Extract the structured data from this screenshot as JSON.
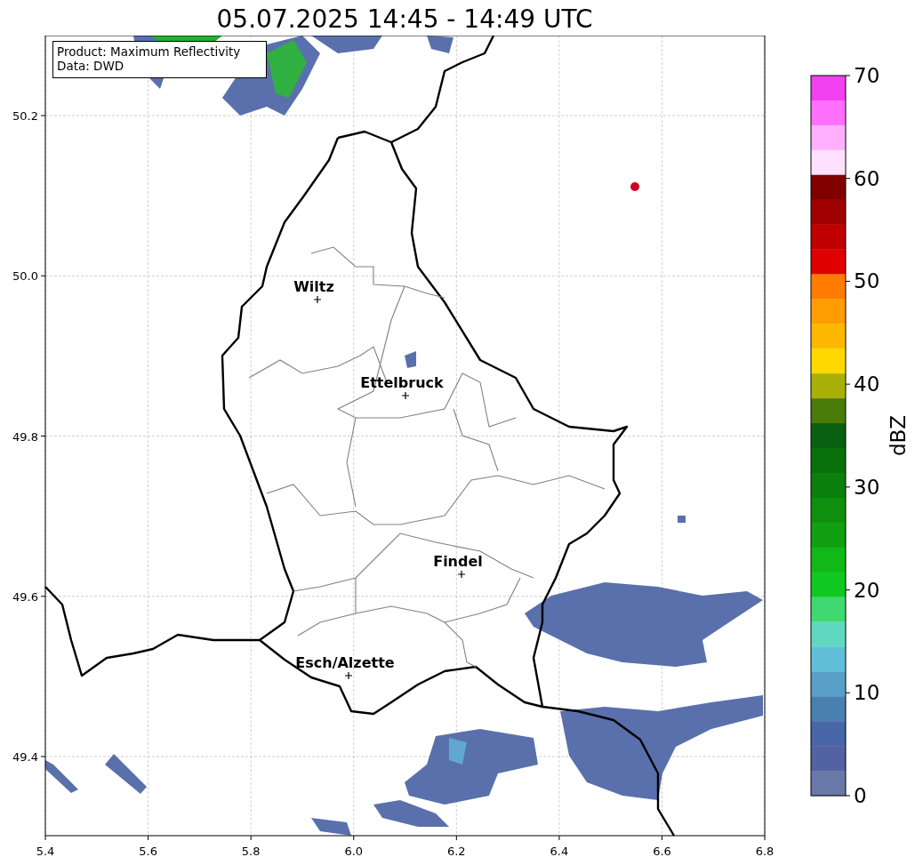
{
  "title": "05.07.2025 14:45 - 14:49 UTC",
  "info_box": [
    "Product: Maximum Reflectivity",
    "Data: DWD"
  ],
  "map": {
    "xticks": [
      "5.4",
      "5.6",
      "5.8",
      "6.0",
      "6.2",
      "6.4",
      "6.6",
      "6.8"
    ],
    "yticks": [
      "50.2",
      "50.0",
      "49.8",
      "49.6",
      "49.4"
    ],
    "cities": [
      {
        "name": "Wiltz"
      },
      {
        "name": "Ettelbruck"
      },
      {
        "name": "Findel"
      },
      {
        "name": "Esch/Alzette"
      }
    ]
  },
  "colorbar": {
    "label": "dBZ",
    "ticks": [
      "70",
      "60",
      "50",
      "40",
      "30",
      "20",
      "10",
      "0"
    ],
    "bands": [
      {
        "color": "#f040f0"
      },
      {
        "color": "#ff70ff"
      },
      {
        "color": "#ffb0ff"
      },
      {
        "color": "#ffe0ff"
      },
      {
        "color": "#800000"
      },
      {
        "color": "#a00000"
      },
      {
        "color": "#c00000"
      },
      {
        "color": "#e00000"
      },
      {
        "color": "#ff7c00"
      },
      {
        "color": "#ff9c00"
      },
      {
        "color": "#ffb800"
      },
      {
        "color": "#ffd800"
      },
      {
        "color": "#a8b008"
      },
      {
        "color": "#4a7a08"
      },
      {
        "color": "#086010"
      },
      {
        "color": "#0a700a"
      },
      {
        "color": "#0c800c"
      },
      {
        "color": "#0e900e"
      },
      {
        "color": "#10a010"
      },
      {
        "color": "#10b818"
      },
      {
        "color": "#10c820"
      },
      {
        "color": "#40d870"
      },
      {
        "color": "#60d8c0"
      },
      {
        "color": "#60c0d8"
      },
      {
        "color": "#58a0c8"
      },
      {
        "color": "#4a80b0"
      },
      {
        "color": "#4866a8"
      },
      {
        "color": "#5262a2"
      },
      {
        "color": "#6a78a8"
      }
    ]
  }
}
